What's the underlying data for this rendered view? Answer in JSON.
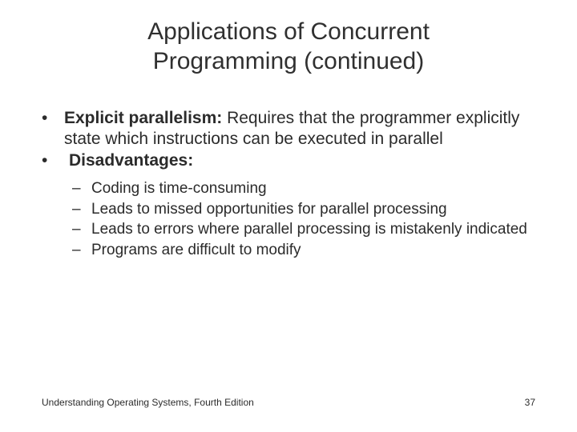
{
  "title_line1": "Applications of Concurrent",
  "title_line2": "Programming (continued)",
  "bullets": [
    {
      "lead": "Explicit parallelism:",
      "rest": " Requires that the programmer explicitly state which instructions can be executed in parallel"
    },
    {
      "lead": "Disadvantages:",
      "rest": "",
      "indent": true
    }
  ],
  "sub_bullets": [
    "Coding is time-consuming",
    "Leads to missed opportunities for parallel processing",
    "Leads to errors where parallel processing is mistakenly indicated",
    "Programs are difficult to modify"
  ],
  "footer_left": "Understanding Operating Systems, Fourth Edition",
  "footer_right": "37"
}
